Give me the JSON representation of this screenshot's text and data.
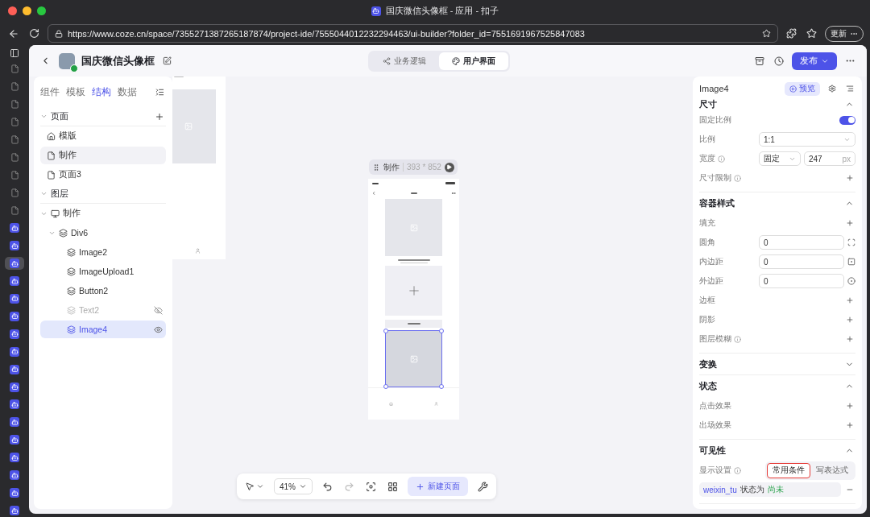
{
  "browser": {
    "title": "国庆微信头像框 - 应用 - 扣子",
    "url": "https://www.coze.cn/space/7355271387265187874/project-ide/7555044012232294463/ui-builder?folder_id=7551691967525847083",
    "update_button": "更新"
  },
  "header": {
    "project_name": "国庆微信头像框",
    "mode_tabs": [
      {
        "label": "业务逻辑",
        "selected": false
      },
      {
        "label": "用户界面",
        "selected": true
      }
    ],
    "publish_button": "发布"
  },
  "left_panel": {
    "tabs": [
      {
        "label": "组件",
        "selected": false
      },
      {
        "label": "模板",
        "selected": false
      },
      {
        "label": "结构",
        "selected": true
      },
      {
        "label": "数据",
        "selected": false
      }
    ],
    "pages": {
      "title": "页面",
      "expanded": true,
      "items": [
        {
          "label": "模版",
          "kind": "home",
          "selected": false
        },
        {
          "label": "制作",
          "kind": "page",
          "selected": true
        },
        {
          "label": "页面3",
          "kind": "page",
          "selected": false
        }
      ]
    },
    "layers": {
      "title": "图层",
      "expanded": true,
      "tree": [
        {
          "label": "制作",
          "kind": "screen",
          "expanded": true,
          "selected": false,
          "hidden": false,
          "children": [
            {
              "label": "Div6",
              "kind": "layer",
              "expanded": true,
              "selected": false,
              "hidden": false,
              "children": [
                {
                  "label": "Image2",
                  "kind": "layer",
                  "selected": false,
                  "hidden": false
                },
                {
                  "label": "ImageUpload1",
                  "kind": "layer",
                  "selected": false,
                  "hidden": false
                },
                {
                  "label": "Button2",
                  "kind": "layer",
                  "selected": false,
                  "hidden": false
                },
                {
                  "label": "Text2",
                  "kind": "layer",
                  "selected": false,
                  "hidden": true
                },
                {
                  "label": "Image4",
                  "kind": "layer",
                  "selected": true,
                  "hidden": false
                }
              ]
            }
          ]
        }
      ]
    }
  },
  "canvas": {
    "main_frame": {
      "page_name": "制作",
      "size": "393 * 852"
    },
    "toolbar": {
      "zoom": "41%",
      "new_page_button": "新建页面"
    }
  },
  "right_panel": {
    "component": "Image4",
    "preview_button": "预览",
    "sections": [
      {
        "title": "尺寸",
        "expanded": true,
        "rows": [
          {
            "kind": "toggle",
            "label": "固定比例",
            "on": true
          },
          {
            "kind": "select",
            "label": "比例",
            "value": "1:1"
          },
          {
            "kind": "size",
            "label": "宽度",
            "info": true,
            "mode": "固定",
            "value": "247",
            "unit": "px"
          },
          {
            "kind": "add",
            "label": "尺寸限制",
            "info": true
          }
        ]
      },
      {
        "title": "容器样式",
        "expanded": true,
        "rows": [
          {
            "kind": "add",
            "label": "填充",
            "info": false
          },
          {
            "kind": "input",
            "label": "圆角",
            "value": "0"
          },
          {
            "kind": "input",
            "label": "内边距",
            "value": "0"
          },
          {
            "kind": "input",
            "label": "外边距",
            "value": "0"
          },
          {
            "kind": "add",
            "label": "边框",
            "info": false
          },
          {
            "kind": "add",
            "label": "阴影",
            "info": false
          },
          {
            "kind": "add",
            "label": "图层模糊",
            "info": true
          }
        ]
      },
      {
        "title": "变换",
        "expanded": false
      },
      {
        "title": "状态",
        "expanded": true,
        "rows": [
          {
            "kind": "add",
            "label": "点击效果",
            "info": false
          },
          {
            "kind": "add",
            "label": "出场效果",
            "info": false
          }
        ]
      },
      {
        "title": "可见性",
        "expanded": true,
        "rows": [
          {
            "kind": "segmented",
            "label": "显示设置",
            "info": true,
            "options": [
              {
                "label": "常用条件",
                "selected": true,
                "highlighted": true
              },
              {
                "label": "写表达式",
                "selected": false,
                "highlighted": false
              }
            ]
          },
          {
            "kind": "condition",
            "variable": "weixin_tu",
            "operator": "状态为",
            "value": "尚未"
          }
        ]
      }
    ]
  }
}
